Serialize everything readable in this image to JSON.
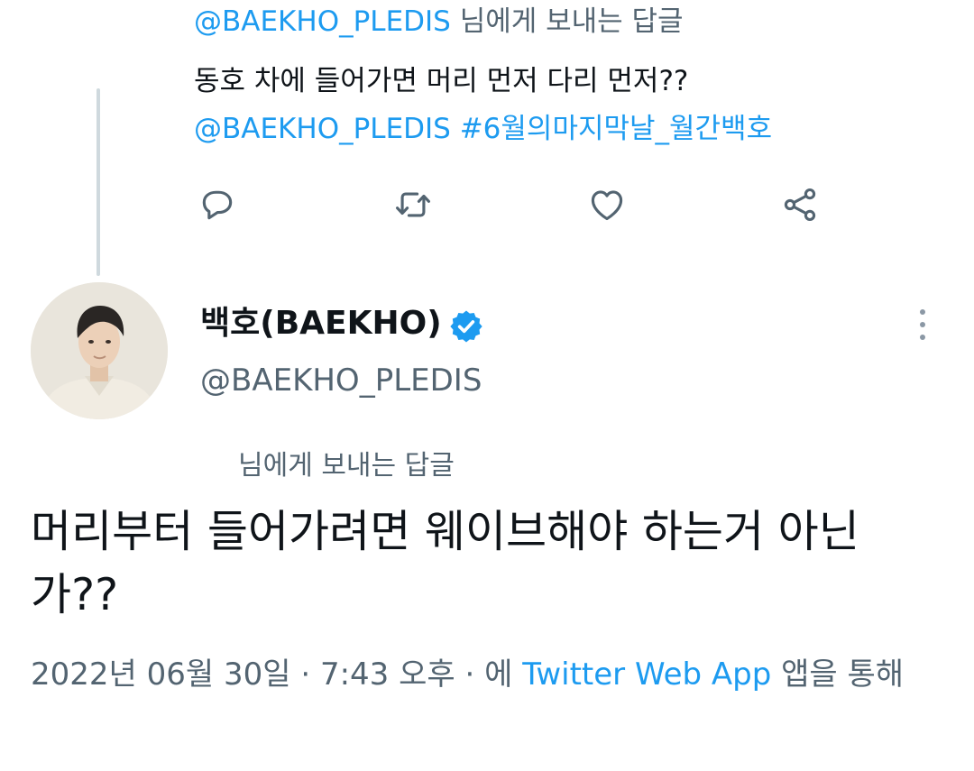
{
  "parent_tweet": {
    "reply_to_handle": "@BAEKHO_PLEDIS",
    "reply_to_suffix": " 님에게 보내는 답글",
    "text_line1": "동호 차에 들어가면 머리 먼저 다리 먼저??",
    "mention": "@BAEKHO_PLEDIS",
    "hashtag": "#6월의마지막날_월간백호",
    "actions": [
      "reply-icon",
      "retweet-icon",
      "like-icon",
      "share-icon"
    ]
  },
  "tweet": {
    "display_name": "백호(BAEKHO)",
    "handle": "@BAEKHO_PLEDIS",
    "verified": true,
    "reply_to_text": "님에게 보내는 답글",
    "text": "머리부터 들어가려면 웨이브해야 하는거 아닌가??",
    "date": "2022년 06월 30일",
    "separator": " · ",
    "time": "7:43 오후",
    "via_prefix": "에 ",
    "source": "Twitter Web App",
    "via_suffix": " 앱을 통해"
  },
  "colors": {
    "link": "#1d9bf0",
    "text": "#0f1419",
    "muted": "#536471",
    "icon": "#536471",
    "thread_line": "#cfd9de"
  }
}
